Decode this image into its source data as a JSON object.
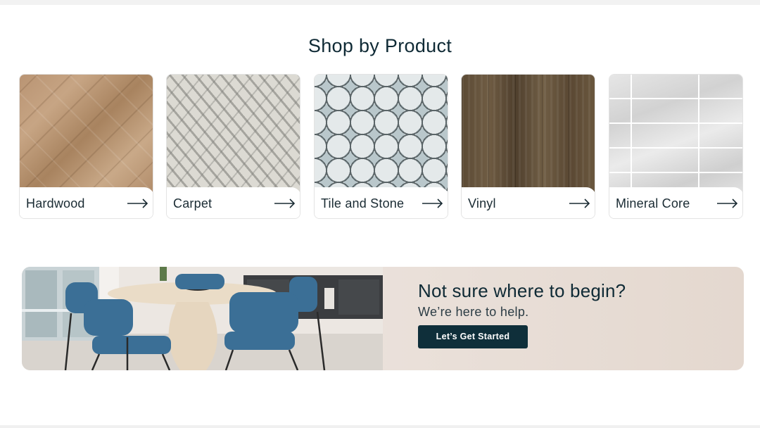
{
  "section": {
    "title": "Shop by Product"
  },
  "products": [
    {
      "label": "Hardwood",
      "icon": "arrow-right-icon"
    },
    {
      "label": "Carpet",
      "icon": "arrow-right-icon"
    },
    {
      "label": "Tile and Stone",
      "icon": "arrow-right-icon"
    },
    {
      "label": "Vinyl",
      "icon": "arrow-right-icon"
    },
    {
      "label": "Mineral Core",
      "icon": "arrow-right-icon"
    }
  ],
  "promo": {
    "heading": "Not sure where to begin?",
    "subheading": "We’re here to help.",
    "button_label": "Let’s Get Started"
  },
  "colors": {
    "text_primary": "#0f2a35",
    "button_bg": "#0f2f3a",
    "promo_bg": "#ece3dd"
  }
}
